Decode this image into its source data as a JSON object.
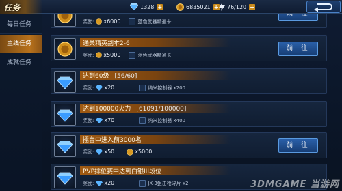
{
  "title": "任务",
  "resources": [
    {
      "icon": "diamond-icon",
      "value": "1328"
    },
    {
      "icon": "gold-coin-icon",
      "value": "6835021"
    },
    {
      "icon": "energy-icon",
      "value": "76/120"
    }
  ],
  "plus_label": "+",
  "sidebar": {
    "items": [
      {
        "label": "每日任务",
        "active": false
      },
      {
        "label": "主线任务",
        "active": true
      },
      {
        "label": "成就任务",
        "active": false
      }
    ]
  },
  "reward_label": "奖励:",
  "go_label": "前 往",
  "tasks": [
    {
      "title": "",
      "progress": "",
      "icon": "gold-coin-icon",
      "rewards": [
        {
          "icon": "gold-coin-icon",
          "qty": "x6000"
        }
      ],
      "item": {
        "icon": "card-icon",
        "text": "蓝色武器精通卡"
      },
      "button": true
    },
    {
      "title": "通关精英副本2-6",
      "progress": "",
      "icon": "gold-coin-icon",
      "rewards": [
        {
          "icon": "gold-coin-icon",
          "qty": "x5000"
        }
      ],
      "item": {
        "icon": "card-icon",
        "text": "蓝色武器精通卡"
      },
      "button": true
    },
    {
      "title": "达到60级",
      "progress": "[56/60]",
      "icon": "diamond-icon",
      "rewards": [
        {
          "icon": "diamond-icon",
          "qty": "x20"
        }
      ],
      "item": {
        "icon": "controller-icon",
        "text": "纳米控制器 x200"
      },
      "button": false
    },
    {
      "title": "达到100000火力",
      "progress": "[61091/100000]",
      "icon": "diamond-icon",
      "rewards": [
        {
          "icon": "diamond-icon",
          "qty": "x70"
        }
      ],
      "item": {
        "icon": "controller-icon",
        "text": "纳米控制器 x400"
      },
      "button": false
    },
    {
      "title": "擂台中进入前3000名",
      "progress": "",
      "icon": "diamond-icon",
      "rewards": [
        {
          "icon": "diamond-icon",
          "qty": "x50"
        },
        {
          "icon": "gold-coin-icon",
          "qty": "x5000"
        }
      ],
      "item": null,
      "button": true
    },
    {
      "title": "PVP排位赛中达到白银III段位",
      "progress": "",
      "icon": "diamond-icon",
      "rewards": [
        {
          "icon": "diamond-icon",
          "qty": "x20"
        }
      ],
      "item": {
        "icon": "fragment-icon",
        "text": "JX-3狙击枪碎片 x2"
      },
      "button": false
    }
  ],
  "watermark": "3DMGAME 当游网"
}
